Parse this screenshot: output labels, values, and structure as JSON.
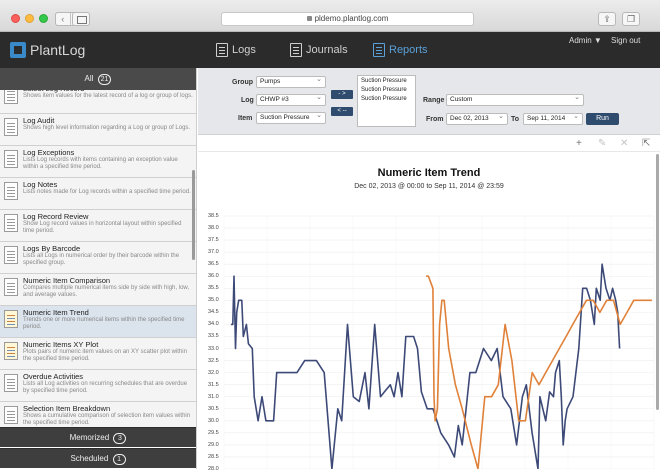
{
  "browser": {
    "url": "pldemo.plantlog.com"
  },
  "app": {
    "logo_text": "PlantLog",
    "nav": [
      {
        "label": "Logs",
        "icon": "logs-icon"
      },
      {
        "label": "Journals",
        "icon": "journals-icon"
      },
      {
        "label": "Reports",
        "icon": "reports-icon"
      }
    ],
    "admin_label": "Admin ▼",
    "signout_label": "Sign out"
  },
  "sidebar": {
    "header_label": "All",
    "header_count": "21",
    "reports": [
      {
        "title": "Latest Log Record",
        "desc": "Shows item values for the latest record of a log or group of logs."
      },
      {
        "title": "Log Audit",
        "desc": "Shows high level information regarding a Log or group of Logs."
      },
      {
        "title": "Log Exceptions",
        "desc": "Lists Log records with items containing an exception value within a specified time period."
      },
      {
        "title": "Log Notes",
        "desc": "Lists notes made for Log records within a specified time period."
      },
      {
        "title": "Log Record Review",
        "desc": "Show Log record values in horizontal layout within specified time period."
      },
      {
        "title": "Logs By Barcode",
        "desc": "Lists all Logs in numerical order by their barcode within the specified group."
      },
      {
        "title": "Numeric Item Comparison",
        "desc": "Compares multiple numerical items side by side with high, low, and average values."
      },
      {
        "title": "Numeric Item Trend",
        "desc": "Trends one or more numerical items within the specified time period."
      },
      {
        "title": "Numeric Items XY Plot",
        "desc": "Plots pairs of numeric item values on an XY scatter plot within the specified time period."
      },
      {
        "title": "Overdue Activities",
        "desc": "Lists all Log activities on recurring schedules that are overdue by specified time period."
      },
      {
        "title": "Selection Item Breakdown",
        "desc": "Shows a cumulative comparison of selection item values within the specified time period."
      }
    ],
    "memorized_label": "Memorized",
    "memorized_count": "3",
    "scheduled_label": "Scheduled",
    "scheduled_count": "1"
  },
  "form": {
    "group_label": "Group",
    "group_value": "Pumps",
    "log_label": "Log",
    "log_value": "CHWP #3",
    "item_label": "Item",
    "item_value": "Suction Pressure",
    "add_btn": "- >",
    "remove_btn": "< --",
    "selected_items": [
      "Suction Pressure",
      "Suction Pressure",
      "Suction Pressure"
    ],
    "range_label": "Range",
    "range_value": "Custom",
    "from_label": "From",
    "from_value": "Dec 02, 2013",
    "to_label": "To",
    "to_value": "Sep 11, 2014",
    "run_label": "Run"
  },
  "toolbar": {
    "add": "+",
    "edit": "✎",
    "close": "✕",
    "export": "⇱"
  },
  "colors": {
    "series_blue": "#3d4a78",
    "series_orange": "#e0813a",
    "accent": "#2f4c6e"
  },
  "chart_data": {
    "type": "line",
    "title": "Numeric Item Trend",
    "subtitle": "Dec 02, 2013 @ 00:00 to Sep 11, 2014 @ 23:59",
    "ylim": [
      28.0,
      38.5
    ],
    "yticks": [
      "38.5",
      "38.0",
      "37.5",
      "37.0",
      "36.5",
      "36.0",
      "35.5",
      "35.0",
      "34.5",
      "34.0",
      "33.5",
      "33.0",
      "32.5",
      "32.0",
      "31.5",
      "31.0",
      "30.5",
      "30.0",
      "29.5",
      "29.0",
      "28.5",
      "28.0"
    ],
    "grid": true,
    "series": [
      {
        "color": "#3d4a78",
        "values": [
          [
            0.0,
            34.0
          ],
          [
            0.005,
            34.0
          ],
          [
            0.008,
            36.0
          ],
          [
            0.012,
            33.0
          ],
          [
            0.015,
            34.5
          ],
          [
            0.02,
            35.0
          ],
          [
            0.028,
            35.0
          ],
          [
            0.032,
            33.5
          ],
          [
            0.04,
            34.0
          ],
          [
            0.045,
            33.2
          ],
          [
            0.055,
            33.0
          ],
          [
            0.06,
            31.0
          ],
          [
            0.07,
            30.0
          ],
          [
            0.08,
            31.0
          ],
          [
            0.09,
            30.0
          ],
          [
            0.11,
            30.0
          ],
          [
            0.118,
            32.0
          ],
          [
            0.15,
            32.0
          ],
          [
            0.17,
            32.0
          ],
          [
            0.19,
            32.5
          ],
          [
            0.22,
            32.5
          ],
          [
            0.24,
            32.0
          ],
          [
            0.26,
            28.0
          ],
          [
            0.275,
            30.5
          ],
          [
            0.285,
            30.0
          ],
          [
            0.3,
            34.0
          ],
          [
            0.315,
            31.0
          ],
          [
            0.33,
            30.8
          ],
          [
            0.345,
            32.0
          ],
          [
            0.355,
            30.5
          ],
          [
            0.37,
            34.0
          ],
          [
            0.385,
            31.0
          ],
          [
            0.395,
            31.2
          ],
          [
            0.41,
            31.5
          ],
          [
            0.42,
            31.0
          ],
          [
            0.43,
            32.0
          ],
          [
            0.44,
            31.0
          ],
          [
            0.45,
            33.5
          ],
          [
            0.47,
            33.5
          ],
          [
            0.48,
            33.0
          ],
          [
            0.49,
            31.2
          ],
          [
            0.505,
            30.5
          ],
          [
            0.52,
            30.5
          ],
          [
            0.54,
            29.5
          ],
          [
            0.56,
            29.0
          ],
          [
            0.575,
            28.5
          ],
          [
            0.585,
            29.8
          ],
          [
            0.595,
            29.0
          ],
          [
            0.605,
            30.5
          ],
          [
            0.615,
            32.0
          ],
          [
            0.63,
            32.0
          ],
          [
            0.65,
            33.0
          ],
          [
            0.67,
            32.5
          ],
          [
            0.685,
            33.0
          ],
          [
            0.7,
            31.0
          ],
          [
            0.72,
            30.5
          ],
          [
            0.735,
            29.0
          ],
          [
            0.75,
            31.0
          ],
          [
            0.76,
            31.5
          ],
          [
            0.775,
            29.5
          ],
          [
            0.79,
            28.0
          ],
          [
            0.795,
            31.0
          ],
          [
            0.81,
            30.0
          ],
          [
            0.82,
            31.2
          ],
          [
            0.83,
            31.0
          ],
          [
            0.835,
            32.0
          ],
          [
            0.845,
            32.5
          ],
          [
            0.85,
            31.0
          ],
          [
            0.855,
            29.0
          ],
          [
            0.86,
            30.0
          ],
          [
            0.865,
            30.5
          ],
          [
            0.88,
            31.0
          ],
          [
            0.895,
            33.0
          ],
          [
            0.905,
            35.5
          ],
          [
            0.915,
            35.5
          ],
          [
            0.925,
            35.0
          ],
          [
            0.935,
            34.0
          ],
          [
            0.94,
            35.5
          ],
          [
            0.95,
            35.0
          ],
          [
            0.955,
            36.5
          ],
          [
            0.965,
            35.5
          ],
          [
            0.975,
            35.0
          ],
          [
            0.982,
            35.5
          ],
          [
            0.99,
            35.0
          ],
          [
            0.995,
            34.5
          ],
          [
            1.0,
            33.0
          ]
        ]
      },
      {
        "color": "#e0813a",
        "values": [
          [
            0.0,
            36.0
          ],
          [
            0.01,
            36.0
          ],
          [
            0.03,
            35.5
          ],
          [
            0.035,
            31.0
          ],
          [
            0.04,
            30.0
          ],
          [
            0.05,
            30.5
          ],
          [
            0.06,
            34.0
          ],
          [
            0.07,
            35.0
          ],
          [
            0.08,
            35.0
          ],
          [
            0.1,
            33.0
          ],
          [
            0.13,
            31.5
          ],
          [
            0.16,
            30.5
          ],
          [
            0.2,
            29.0
          ],
          [
            0.23,
            28.0
          ],
          [
            0.26,
            31.0
          ],
          [
            0.29,
            31.0
          ],
          [
            0.32,
            31.5
          ],
          [
            0.35,
            34.0
          ],
          [
            0.38,
            32.5
          ],
          [
            0.41,
            30.0
          ],
          [
            0.44,
            30.0
          ],
          [
            0.47,
            32.0
          ],
          [
            0.5,
            31.5
          ],
          [
            0.53,
            32.0
          ],
          [
            0.56,
            32.5
          ],
          [
            0.59,
            33.0
          ],
          [
            0.62,
            33.5
          ],
          [
            0.65,
            34.0
          ],
          [
            0.68,
            34.5
          ],
          [
            0.71,
            35.0
          ],
          [
            0.74,
            35.0
          ],
          [
            0.77,
            34.5
          ],
          [
            0.8,
            35.0
          ],
          [
            0.83,
            35.0
          ],
          [
            0.86,
            34.0
          ],
          [
            0.89,
            34.5
          ],
          [
            0.92,
            35.0
          ],
          [
            0.95,
            35.0
          ],
          [
            1.0,
            35.0
          ]
        ]
      }
    ]
  }
}
